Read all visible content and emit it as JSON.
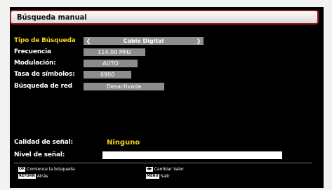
{
  "title": "Búsqueda manual",
  "fields": {
    "search_type": {
      "label": "Tipo de Búsqueda",
      "value": "Cable Digital"
    },
    "frequency": {
      "label": "Frecuencia",
      "value": "114.00 MHz"
    },
    "modulation": {
      "label": "Modulación:",
      "value": "AUTO"
    },
    "symbol_rate": {
      "label": "Tasa de símbolos:",
      "value": "6900"
    },
    "network_search": {
      "label": "Búsqueda de red",
      "value": "Desactivada"
    }
  },
  "signal": {
    "quality_label": "Calidad de señal:",
    "quality_value": "Ninguno",
    "level_label": "Nivel de señal:"
  },
  "hints": {
    "ok_key": "OK",
    "ok_text": "Comience la búsqueda",
    "return_key": "RETURN",
    "return_text": "Atrás",
    "arrows_key": "◀▶",
    "arrows_text": "Cambiar Valor",
    "menu_key": "MENU",
    "menu_text": "Salir"
  },
  "icons": {
    "left_arrow": "chevron-left-icon",
    "right_arrow": "chevron-right-icon"
  }
}
